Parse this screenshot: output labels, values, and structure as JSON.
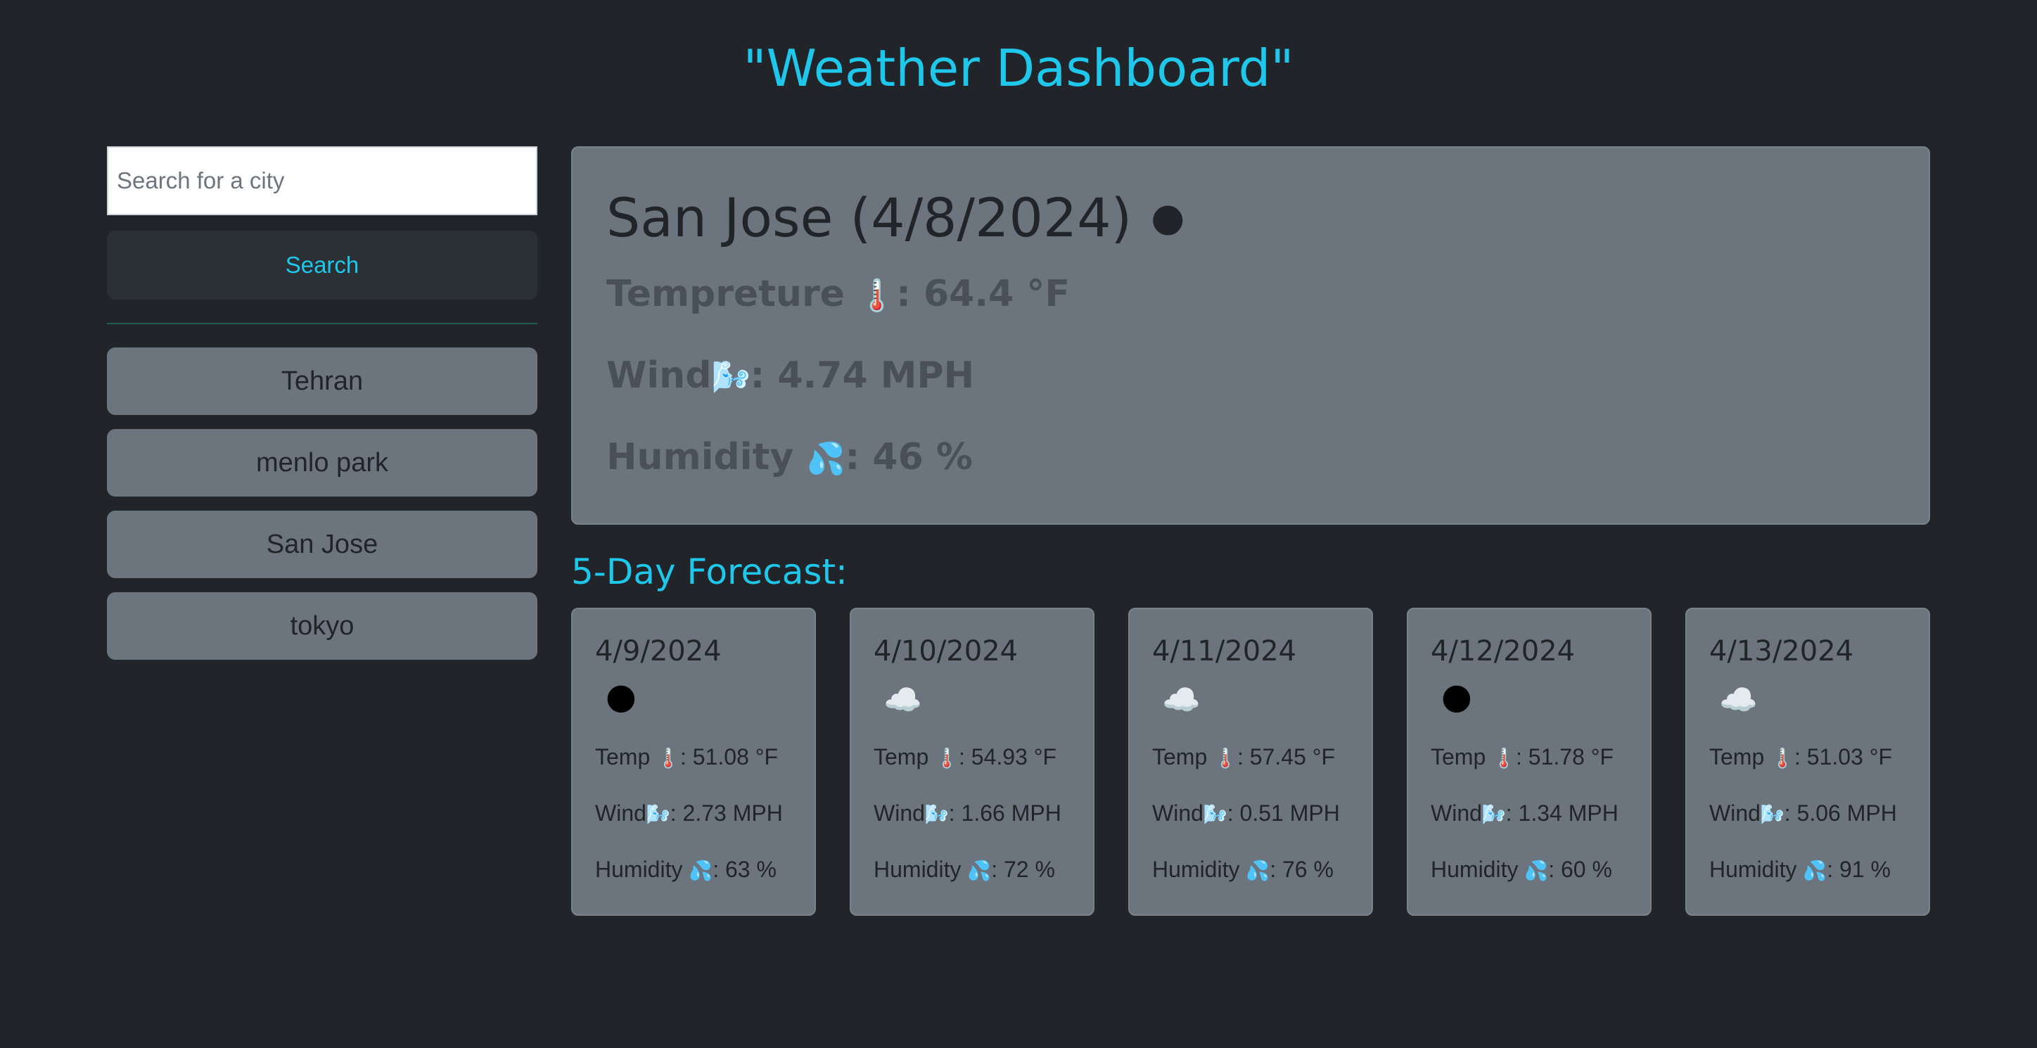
{
  "header": {
    "title": "\"Weather Dashboard\""
  },
  "search": {
    "placeholder": "Search for a city",
    "button_label": "Search"
  },
  "history": [
    "Tehran",
    "menlo park",
    "San Jose",
    "tokyo"
  ],
  "current": {
    "heading": "San Jose (4/8/2024)",
    "icon": "🌑",
    "temp_label": "Tempreture",
    "temp_icon": "🌡️",
    "temp_value": ": 64.4 °F",
    "wind_label": "Wind",
    "wind_icon": "🌬️",
    "wind_value": ": 4.74 MPH",
    "humidity_label": "Humidity",
    "humidity_icon": "💦",
    "humidity_value": ": 46 %"
  },
  "forecast_title": "5-Day Forecast:",
  "forecast": [
    {
      "date": "4/9/2024",
      "icon": "🌑",
      "temp_label": "Temp",
      "temp_icon": "🌡️",
      "temp": ": 51.08 °F",
      "wind_label": "Wind",
      "wind_icon": "🌬️",
      "wind": ": 2.73 MPH",
      "humidity_label": "Humidity",
      "humidity_icon": "💦",
      "humidity": ": 63 %"
    },
    {
      "date": "4/10/2024",
      "icon": "☁️",
      "temp_label": "Temp",
      "temp_icon": "🌡️",
      "temp": ": 54.93 °F",
      "wind_label": "Wind",
      "wind_icon": "🌬️",
      "wind": ": 1.66 MPH",
      "humidity_label": "Humidity",
      "humidity_icon": "💦",
      "humidity": ": 72 %"
    },
    {
      "date": "4/11/2024",
      "icon": "☁️",
      "temp_label": "Temp",
      "temp_icon": "🌡️",
      "temp": ": 57.45 °F",
      "wind_label": "Wind",
      "wind_icon": "🌬️",
      "wind": ": 0.51 MPH",
      "humidity_label": "Humidity",
      "humidity_icon": "💦",
      "humidity": ": 76 %"
    },
    {
      "date": "4/12/2024",
      "icon": "🌑",
      "temp_label": "Temp",
      "temp_icon": "🌡️",
      "temp": ": 51.78 °F",
      "wind_label": "Wind",
      "wind_icon": "🌬️",
      "wind": ": 1.34 MPH",
      "humidity_label": "Humidity",
      "humidity_icon": "💦",
      "humidity": ": 60 %"
    },
    {
      "date": "4/13/2024",
      "icon": "☁️",
      "temp_label": "Temp",
      "temp_icon": "🌡️",
      "temp": ": 51.03 °F",
      "wind_label": "Wind",
      "wind_icon": "🌬️",
      "wind": ": 5.06 MPH",
      "humidity_label": "Humidity",
      "humidity_icon": "💦",
      "humidity": ": 91 %"
    }
  ],
  "colors": {
    "background": "#212529",
    "accent": "#1fc8eb",
    "card": "#6c757d",
    "search_button": "#2b3035"
  }
}
